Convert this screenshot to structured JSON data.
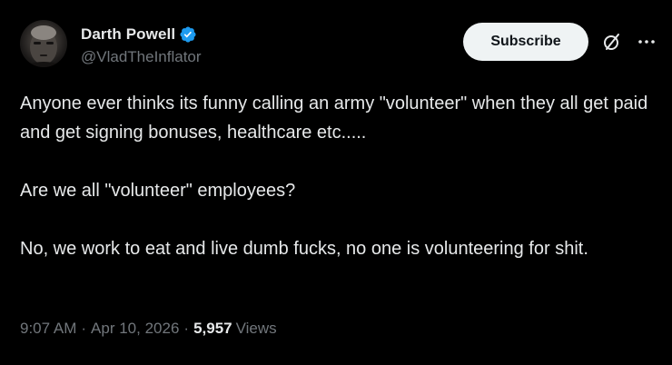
{
  "author": {
    "display_name": "Darth Powell",
    "handle": "@VladTheInflator",
    "verified": true,
    "avatar_icon": "user-avatar"
  },
  "actions": {
    "subscribe_label": "Subscribe",
    "grok_icon": "grok-icon",
    "more_icon": "more-options-icon"
  },
  "tweet": {
    "paragraphs": [
      "Anyone ever thinks its funny calling an army \"volunteer\" when they all get paid and get signing bonuses, healthcare etc.....",
      "Are we all \"volunteer\" employees?",
      "No, we work to eat and live dumb fucks, no one is volunteering for shit."
    ]
  },
  "meta": {
    "time": "9:07 AM",
    "separator": "·",
    "date": "Apr 10, 2026",
    "views_count": "5,957",
    "views_label": "Views"
  },
  "colors": {
    "background": "#000000",
    "text_primary": "#e7e9ea",
    "text_secondary": "#71767b",
    "verified_blue": "#1d9bf0",
    "button_bg": "#eff3f4"
  }
}
